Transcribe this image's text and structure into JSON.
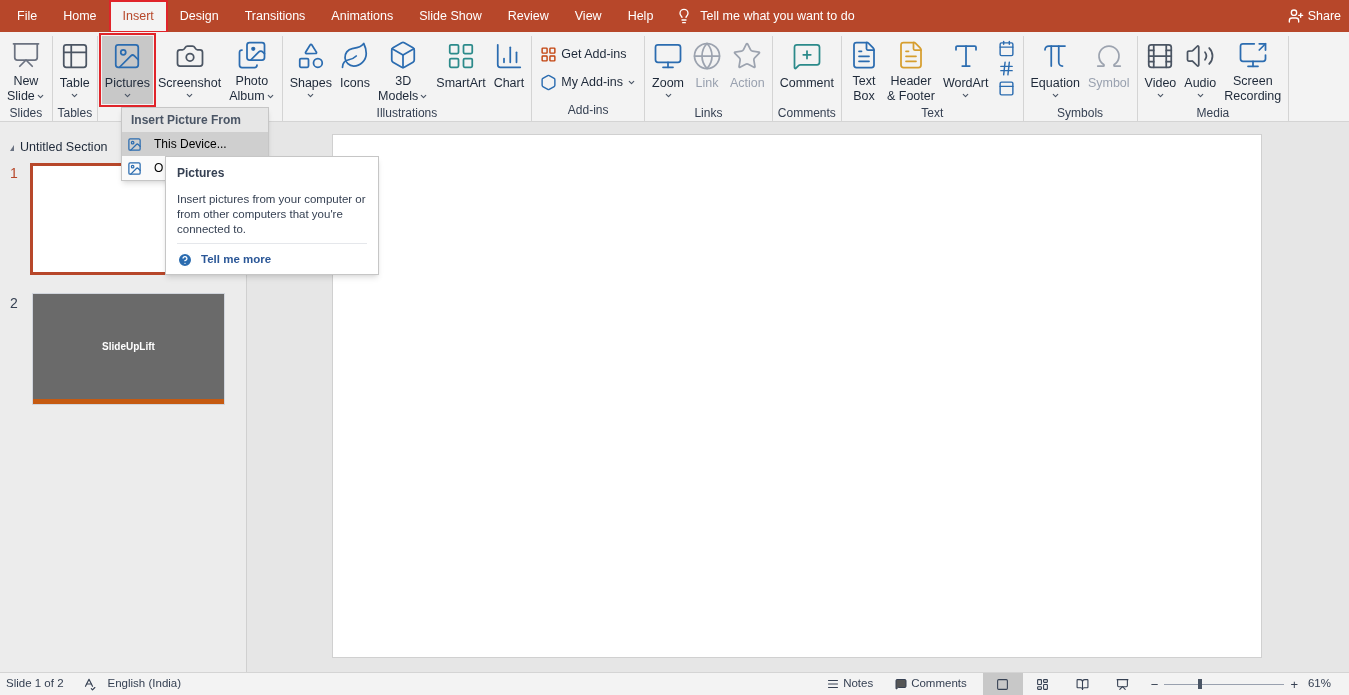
{
  "tabs": [
    {
      "label": "File",
      "selected": false
    },
    {
      "label": "Home",
      "selected": false
    },
    {
      "label": "Insert",
      "selected": true
    },
    {
      "label": "Design",
      "selected": false
    },
    {
      "label": "Transitions",
      "selected": false
    },
    {
      "label": "Animations",
      "selected": false
    },
    {
      "label": "Slide Show",
      "selected": false
    },
    {
      "label": "Review",
      "selected": false
    },
    {
      "label": "View",
      "selected": false
    },
    {
      "label": "Help",
      "selected": false
    }
  ],
  "tell_me": {
    "placeholder": "Tell me what you want to do"
  },
  "share": "Share",
  "ribbon_groups": [
    {
      "label": "Slides",
      "buttons": [
        {
          "kind": "large",
          "lines": [
            "New",
            "Slide"
          ],
          "dropdown": true,
          "disabled": false,
          "pressed": false
        }
      ]
    },
    {
      "label": "Tables",
      "buttons": [
        {
          "kind": "large",
          "lines": [
            "Table"
          ],
          "dropdown": true,
          "disabled": false,
          "pressed": false
        }
      ]
    },
    {
      "buttons": [
        {
          "kind": "large",
          "lines": [
            "Pictures"
          ],
          "dropdown": true,
          "disabled": false,
          "pressed": true
        },
        {
          "kind": "large",
          "lines": [
            "Screenshot"
          ],
          "dropdown": true,
          "disabled": false,
          "pressed": false
        },
        {
          "kind": "large",
          "lines": [
            "Photo",
            "Album"
          ],
          "dropdown": true,
          "disabled": false,
          "pressed": false
        }
      ]
    },
    {
      "label": "Illustrations",
      "buttons": [
        {
          "kind": "large",
          "lines": [
            "Shapes"
          ],
          "dropdown": true,
          "disabled": false,
          "pressed": false
        },
        {
          "kind": "large",
          "lines": [
            "Icons"
          ],
          "dropdown": false,
          "disabled": false,
          "pressed": false
        },
        {
          "kind": "large",
          "lines": [
            "3D",
            "Models"
          ],
          "dropdown": true,
          "disabled": false,
          "pressed": false
        },
        {
          "kind": "large",
          "lines": [
            "SmartArt"
          ],
          "dropdown": false,
          "disabled": false,
          "pressed": false
        },
        {
          "kind": "large",
          "lines": [
            "Chart"
          ],
          "dropdown": false,
          "disabled": false,
          "pressed": false
        }
      ]
    },
    {
      "label": "Add-ins",
      "buttons": [
        {
          "kind": "small",
          "lines": [
            "Get Add-ins"
          ],
          "dropdown": false,
          "disabled": false,
          "pressed": false
        },
        {
          "kind": "small",
          "lines": [
            "My Add-ins"
          ],
          "dropdown": true,
          "disabled": false,
          "pressed": false
        }
      ]
    },
    {
      "label": "Links",
      "buttons": [
        {
          "kind": "large",
          "lines": [
            "Zoom"
          ],
          "dropdown": true,
          "disabled": false,
          "pressed": false
        },
        {
          "kind": "large",
          "lines": [
            "Link"
          ],
          "dropdown": false,
          "disabled": true,
          "pressed": false
        },
        {
          "kind": "large",
          "lines": [
            "Action"
          ],
          "dropdown": false,
          "disabled": true,
          "pressed": false
        }
      ]
    },
    {
      "label": "Comments",
      "buttons": [
        {
          "kind": "large",
          "lines": [
            "Comment"
          ],
          "dropdown": false,
          "disabled": false,
          "pressed": false
        }
      ]
    },
    {
      "label": "Text",
      "buttons": [
        {
          "kind": "large",
          "lines": [
            "Text",
            "Box"
          ],
          "dropdown": false,
          "disabled": false,
          "pressed": false
        },
        {
          "kind": "large",
          "lines": [
            "Header",
            "& Footer"
          ],
          "dropdown": false,
          "disabled": false,
          "pressed": false
        },
        {
          "kind": "large",
          "lines": [
            "WordArt"
          ],
          "dropdown": true,
          "disabled": false,
          "pressed": false
        },
        {
          "kind": "stack"
        }
      ]
    },
    {
      "label": "Symbols",
      "buttons": [
        {
          "kind": "large",
          "lines": [
            "Equation"
          ],
          "dropdown": true,
          "disabled": false,
          "pressed": false
        },
        {
          "kind": "large",
          "lines": [
            "Symbol"
          ],
          "dropdown": false,
          "disabled": true,
          "pressed": false
        }
      ]
    },
    {
      "label": "Media",
      "buttons": [
        {
          "kind": "large",
          "lines": [
            "Video"
          ],
          "dropdown": true,
          "disabled": false,
          "pressed": false
        },
        {
          "kind": "large",
          "lines": [
            "Audio"
          ],
          "dropdown": true,
          "disabled": false,
          "pressed": false
        },
        {
          "kind": "large",
          "lines": [
            "Screen",
            "Recording"
          ],
          "dropdown": false,
          "disabled": false,
          "pressed": false
        }
      ]
    }
  ],
  "picture_menu": {
    "header": "Insert Picture From",
    "items": [
      {
        "label": "This Device...",
        "selected": true
      },
      {
        "label": "O",
        "selected": false
      }
    ]
  },
  "tooltip": {
    "title": "Pictures",
    "body": "Insert pictures from your computer or from other computers that you're connected to.",
    "link": "Tell me more"
  },
  "slides_panel": {
    "section": "Untitled Section",
    "slides": [
      {
        "number": "1",
        "selected": true
      },
      {
        "number": "2",
        "selected": false,
        "title": "SlideUpLift"
      }
    ]
  },
  "status_bar": {
    "slide": "Slide 1 of 2",
    "language": "English (India)",
    "notes": "Notes",
    "comments": "Comments",
    "views": [
      {
        "selected": true
      },
      {
        "selected": false
      },
      {
        "selected": false
      },
      {
        "selected": false
      }
    ],
    "zoom": {
      "out": "−",
      "in": "+",
      "level": 0.3,
      "reading": "61%"
    }
  }
}
